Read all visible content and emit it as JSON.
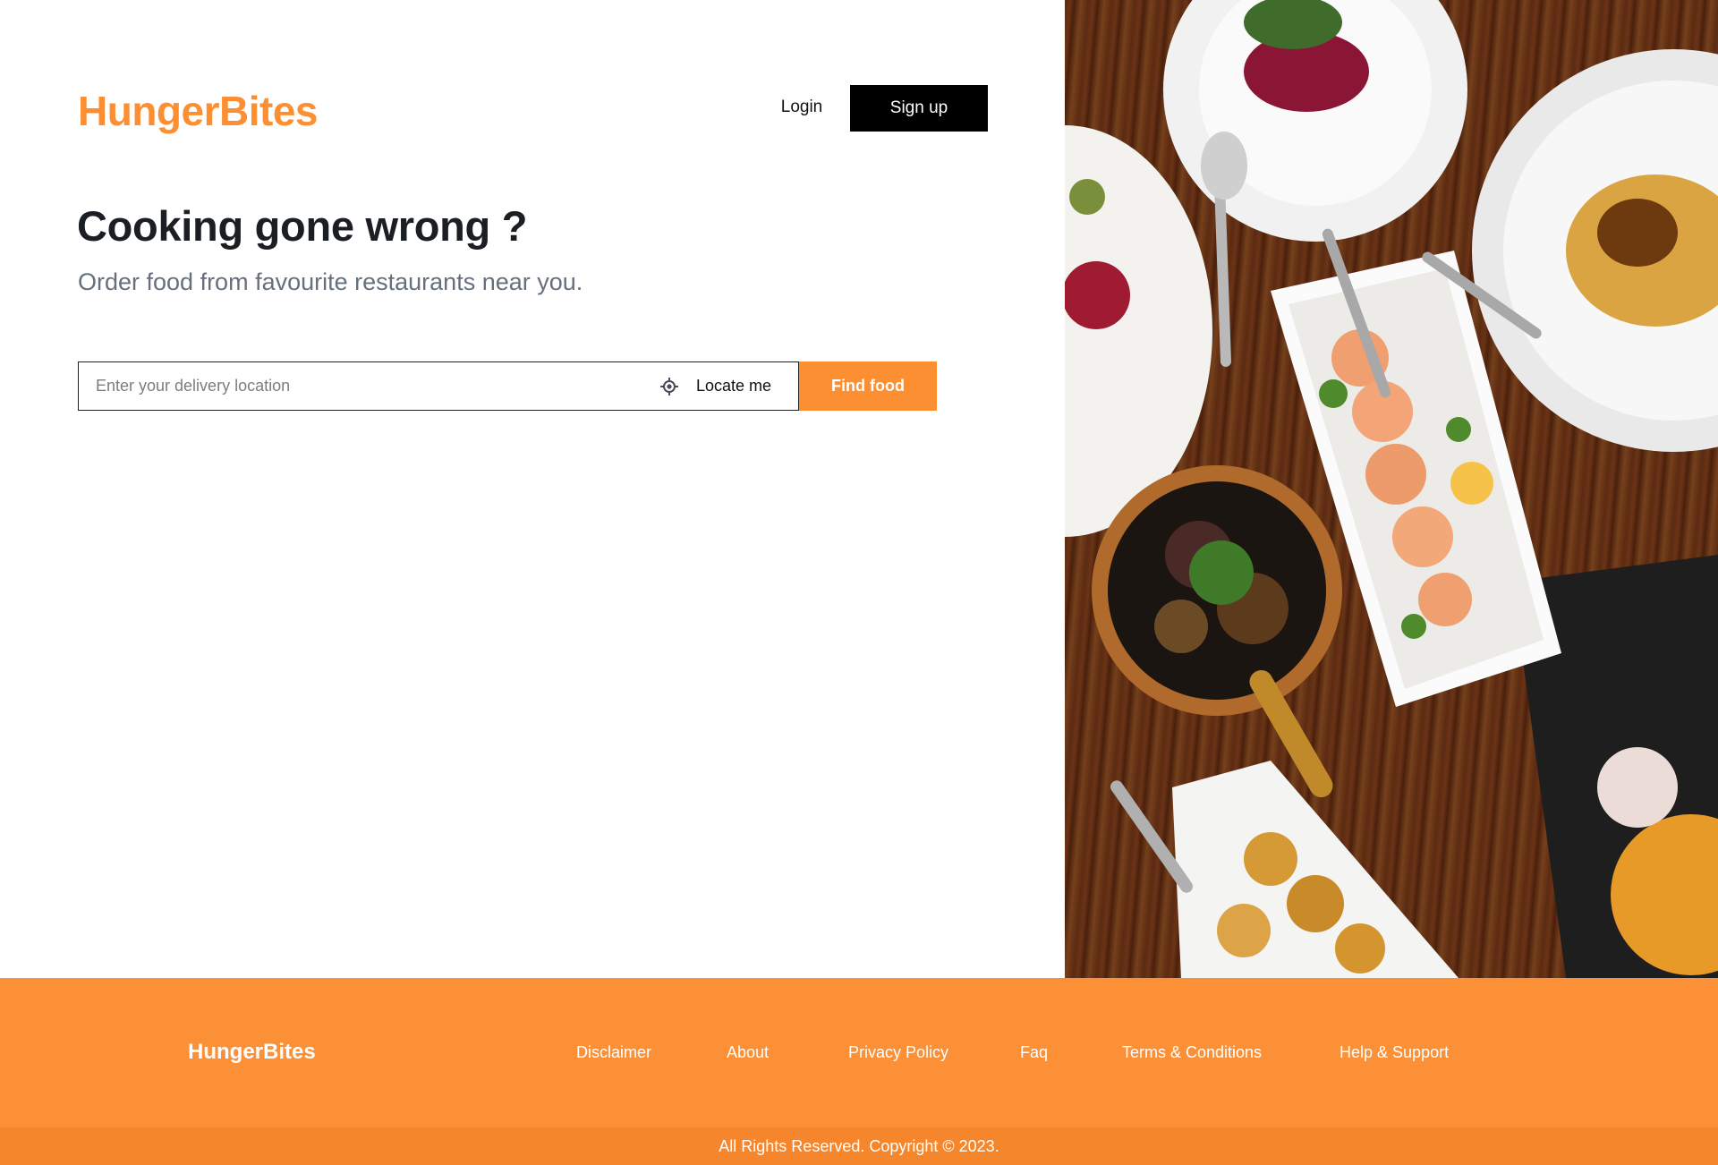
{
  "brand": {
    "name": "HungerBites",
    "accent_color": "#fc8f32"
  },
  "header": {
    "login_label": "Login",
    "signup_label": "Sign up"
  },
  "hero": {
    "headline": "Cooking gone wrong ?",
    "subheadline": "Order food from favourite restaurants near you.",
    "image_icon": "food-table-photo"
  },
  "search": {
    "value": "",
    "placeholder": "Enter your delivery location",
    "locate_icon": "crosshair-icon",
    "locate_label": "Locate me",
    "submit_label": "Find food"
  },
  "footer": {
    "brand": "HungerBites",
    "links": [
      "Disclaimer",
      "About",
      "Privacy Policy",
      "Faq",
      "Terms & Conditions",
      "Help & Support"
    ],
    "copyright": "All Rights Reserved. Copyright © 2023."
  }
}
